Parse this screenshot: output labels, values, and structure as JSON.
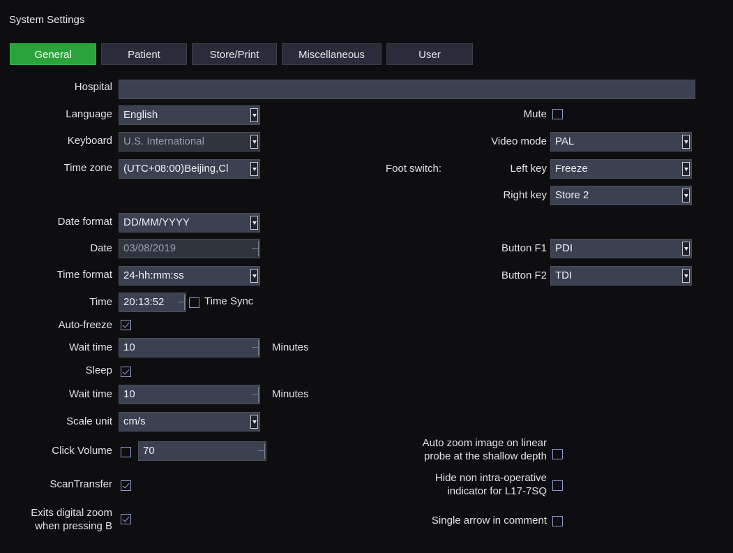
{
  "window_title": "System Settings",
  "tabs": [
    {
      "label": "General",
      "active": true
    },
    {
      "label": "Patient",
      "active": false
    },
    {
      "label": "Store/Print",
      "active": false
    },
    {
      "label": "Miscellaneous",
      "active": false
    },
    {
      "label": "User",
      "active": false
    }
  ],
  "general": {
    "hospital": {
      "label": "Hospital",
      "value": ""
    },
    "language": {
      "label": "Language",
      "value": "English"
    },
    "keyboard": {
      "label": "Keyboard",
      "value": "U.S. International"
    },
    "time_zone": {
      "label": "Time zone",
      "value": "(UTC+08:00)Beijing,Cl"
    },
    "date_format": {
      "label": "Date format",
      "value": "DD/MM/YYYY"
    },
    "date": {
      "label": "Date",
      "value": "03/08/2019"
    },
    "time_format": {
      "label": "Time format",
      "value": "24-hh:mm:ss"
    },
    "time": {
      "label": "Time",
      "value": "20:13:52"
    },
    "time_sync": {
      "label": "Time Sync",
      "checked": false
    },
    "auto_freeze": {
      "label": "Auto-freeze",
      "checked": true
    },
    "auto_freeze_wait": {
      "label": "Wait time",
      "value": "10",
      "unit": "Minutes"
    },
    "sleep": {
      "label": "Sleep",
      "checked": true
    },
    "sleep_wait": {
      "label": "Wait time",
      "value": "10",
      "unit": "Minutes"
    },
    "scale_unit": {
      "label": "Scale unit",
      "value": "cm/s"
    },
    "click_volume": {
      "label": "Click Volume",
      "checked": false,
      "value": "70"
    },
    "scan_transfer": {
      "label": "ScanTransfer",
      "checked": true
    },
    "exits_digital_zoom": {
      "label_line1": "Exits digital zoom",
      "label_line2": "when pressing B",
      "checked": true
    }
  },
  "right": {
    "mute": {
      "label": "Mute",
      "checked": false
    },
    "video_mode": {
      "label": "Video mode",
      "value": "PAL"
    },
    "foot_switch_label": "Foot switch:",
    "left_key": {
      "label": "Left key",
      "value": "Freeze"
    },
    "right_key": {
      "label": "Right key",
      "value": "Store 2"
    },
    "button_f1": {
      "label": "Button F1",
      "value": "PDI"
    },
    "button_f2": {
      "label": "Button F2",
      "value": "TDI"
    },
    "auto_zoom": {
      "label_line1": "Auto zoom image on linear",
      "label_line2": "probe at the shallow depth",
      "checked": false
    },
    "hide_non_intra": {
      "label_line1": "Hide non intra-operative",
      "label_line2": "indicator for L17-7SQ",
      "checked": false
    },
    "single_arrow": {
      "label": "Single arrow in comment",
      "checked": false
    }
  }
}
